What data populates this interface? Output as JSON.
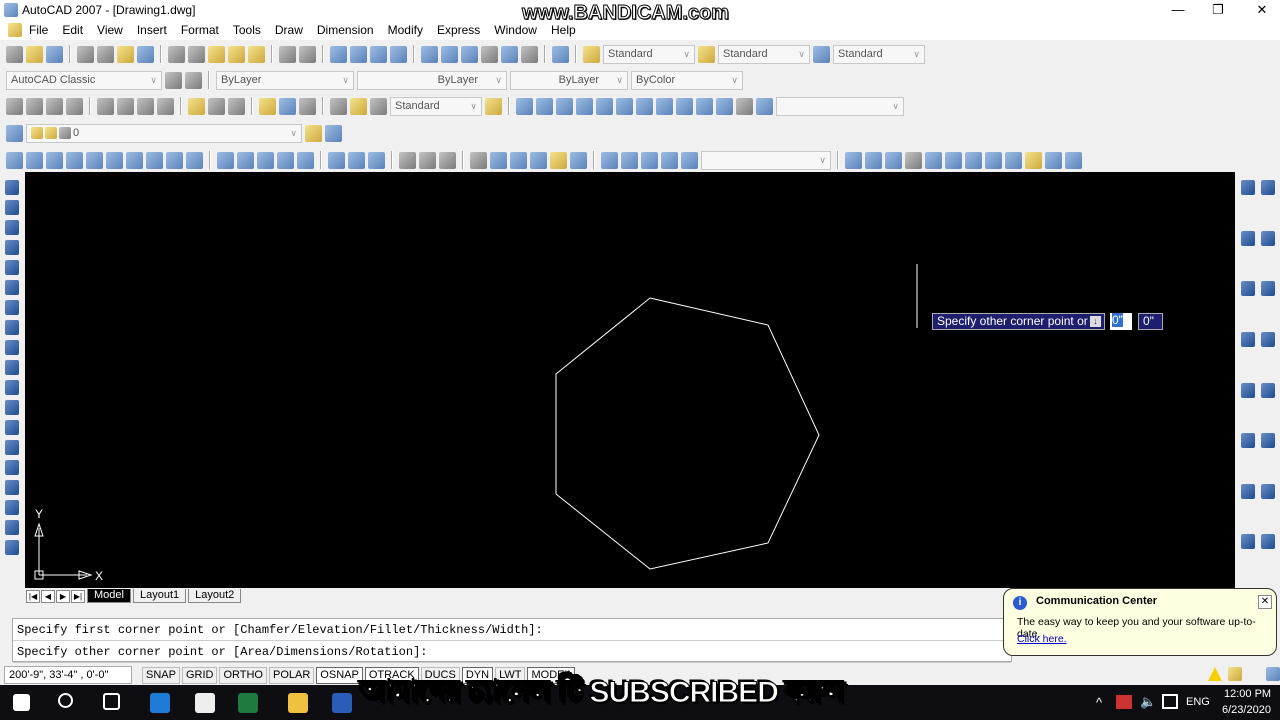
{
  "window": {
    "title": "AutoCAD 2007 - [Drawing1.dwg]",
    "minimize": "—",
    "restore": "❐",
    "close": "✕"
  },
  "watermark": "www.BANDICAM.com",
  "menu": [
    "File",
    "Edit",
    "View",
    "Insert",
    "Format",
    "Tools",
    "Draw",
    "Dimension",
    "Modify",
    "Express",
    "Window",
    "Help"
  ],
  "toolbars": {
    "text_style": "Standard",
    "dim_style": "Standard",
    "table_style": "Standard",
    "workspace": "AutoCAD Classic",
    "color": "ByLayer",
    "linetype": "ByLayer",
    "lineweight": "ByLayer",
    "plotstyle": "ByColor",
    "dim_style2": "Standard",
    "layer": "0"
  },
  "tooltip": {
    "prompt": "Specify other corner point or",
    "x_value": "0\"",
    "y_value": "0\""
  },
  "ucs": {
    "x": "X",
    "y": "Y"
  },
  "tabs": {
    "model": "Model",
    "layout1": "Layout1",
    "layout2": "Layout2"
  },
  "command_lines": [
    "Specify first corner point or [Chamfer/Elevation/Fillet/Thickness/Width]:",
    "Specify other corner point or [Area/Dimensions/Rotation]:"
  ],
  "status": {
    "coords": "200'-9\", 33'-4\" , 0'-0\"",
    "buttons": [
      "SNAP",
      "GRID",
      "ORTHO",
      "POLAR",
      "OSNAP",
      "OTRACK",
      "DUCS",
      "DYN",
      "LWT",
      "MODEL"
    ]
  },
  "balloon": {
    "title": "Communication Center",
    "message": "The easy way to keep you and your software up-to-date.",
    "link": "Click here.",
    "close": "✕"
  },
  "subtitle": "আমাদের চ্যানেল টি SUBSCRIBED করুন",
  "taskbar": {
    "lang": "ENG",
    "time": "12:00 PM",
    "date": "6/23/2020"
  }
}
